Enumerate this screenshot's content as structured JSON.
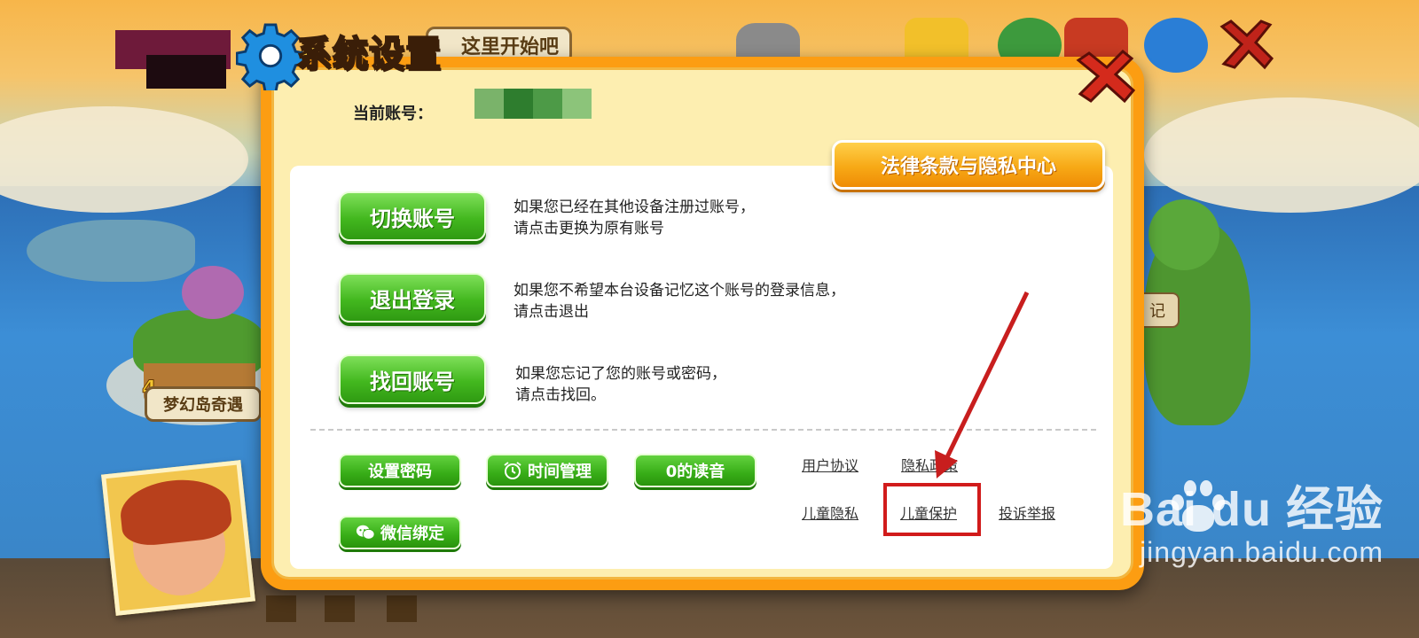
{
  "background": {
    "top_banner_text": "这里开始吧",
    "island_number": "4",
    "island_label": "梦幻岛奇遇",
    "side_label": "记"
  },
  "dialog": {
    "title": "系统设置",
    "account_label": "当前账号：",
    "legal_button": "法律条款与隐私中心",
    "actions": [
      {
        "label": "切换账号",
        "desc_line1": "如果您已经在其他设备注册过账号，",
        "desc_line2": "请点击更换为原有账号"
      },
      {
        "label": "退出登录",
        "desc_line1": "如果您不希望本台设备记忆这个账号的登录信息，",
        "desc_line2": "请点击退出"
      },
      {
        "label": "找回账号",
        "desc_line1": "如果您忘记了您的账号或密码，",
        "desc_line2": "请点击找回。"
      }
    ],
    "small_buttons": {
      "set_password": "设置密码",
      "time_management": "时间管理",
      "voice_reading": "0的读音",
      "wechat_bind": "微信绑定"
    },
    "links": {
      "user_agreement": "用户协议",
      "privacy_policy": "隐私政策",
      "child_privacy": "儿童隐私",
      "child_protection": "儿童保护",
      "complaint": "投诉举报"
    }
  },
  "watermark": {
    "logo": "Bai du 经验",
    "url": "jingyan.baidu.com"
  },
  "colors": {
    "dialog_border": "#fc9d12",
    "dialog_fill": "#fdeeb0",
    "green_button": "#43b81f",
    "orange_button": "#f7a916",
    "highlight_red": "#d11b1b"
  }
}
